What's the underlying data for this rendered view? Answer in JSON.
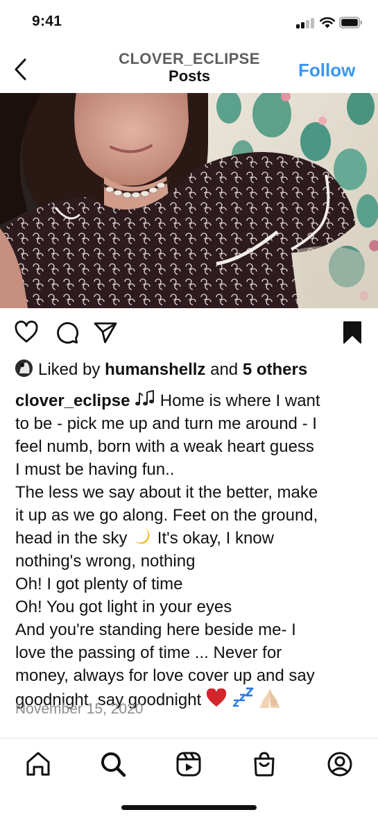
{
  "status_bar": {
    "time": "9:41"
  },
  "header": {
    "username": "CLOVER_ECLIPSE",
    "title": "Posts",
    "follow_label": "Follow"
  },
  "post": {
    "likes": {
      "prefix": "Liked by",
      "liker": "humanshellz",
      "conjunction": "and",
      "others": "5 others"
    },
    "caption": {
      "username": "clover_eclipse",
      "line1_text": "Home is where I want",
      "line2": "to be - pick me up and turn me around - I",
      "line3": "feel numb, born with a weak heart guess",
      "line4": "I must be having fun..",
      "line5": "The less we say about it the better, make",
      "line6": "it up as we go along. Feet on the ground,",
      "line7a": "head in the sky",
      "line7b": "It's okay, I know",
      "line8": "nothing's wrong, nothing",
      "line9": "Oh! I got plenty of time",
      "line10": "Oh! You got light in your eyes",
      "line11": "And you're standing here beside me- I",
      "line12": "love the passing of time ... Never for",
      "line13": "money, always for love cover up and say",
      "line14": "goodnight, say goodnight"
    },
    "date": "November 15, 2020"
  },
  "icons": {
    "back": "chevron-left-icon",
    "like": "heart-icon",
    "comment": "comment-icon",
    "share": "send-icon",
    "save": "bookmark-icon",
    "tabs": [
      "home-icon",
      "search-icon",
      "reels-icon",
      "shop-icon",
      "profile-icon"
    ]
  },
  "colors": {
    "accent": "#3897f0",
    "text": "#111111",
    "muted": "#8e8e8e",
    "header_username": "#5d5d5d"
  }
}
